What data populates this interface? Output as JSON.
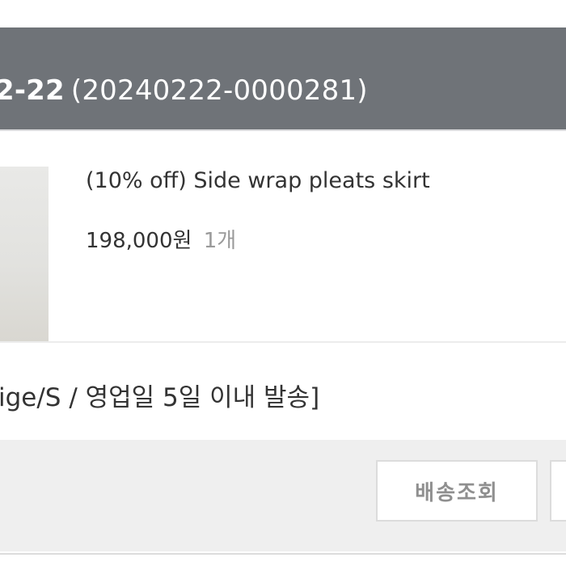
{
  "order_header": {
    "date": "2-22",
    "order_number": "(20240222-0000281)"
  },
  "product": {
    "name": "(10% off) Side wrap pleats skirt",
    "price": "198,000원",
    "quantity": "1개"
  },
  "option": {
    "text": "ige/S / 영업일 5일 이내 발송]"
  },
  "actions": {
    "tracking_label": "배송조회"
  },
  "colors": {
    "header_bg": "#6f7378",
    "action_bg": "#efefef",
    "button_text": "#8f8f8f"
  }
}
